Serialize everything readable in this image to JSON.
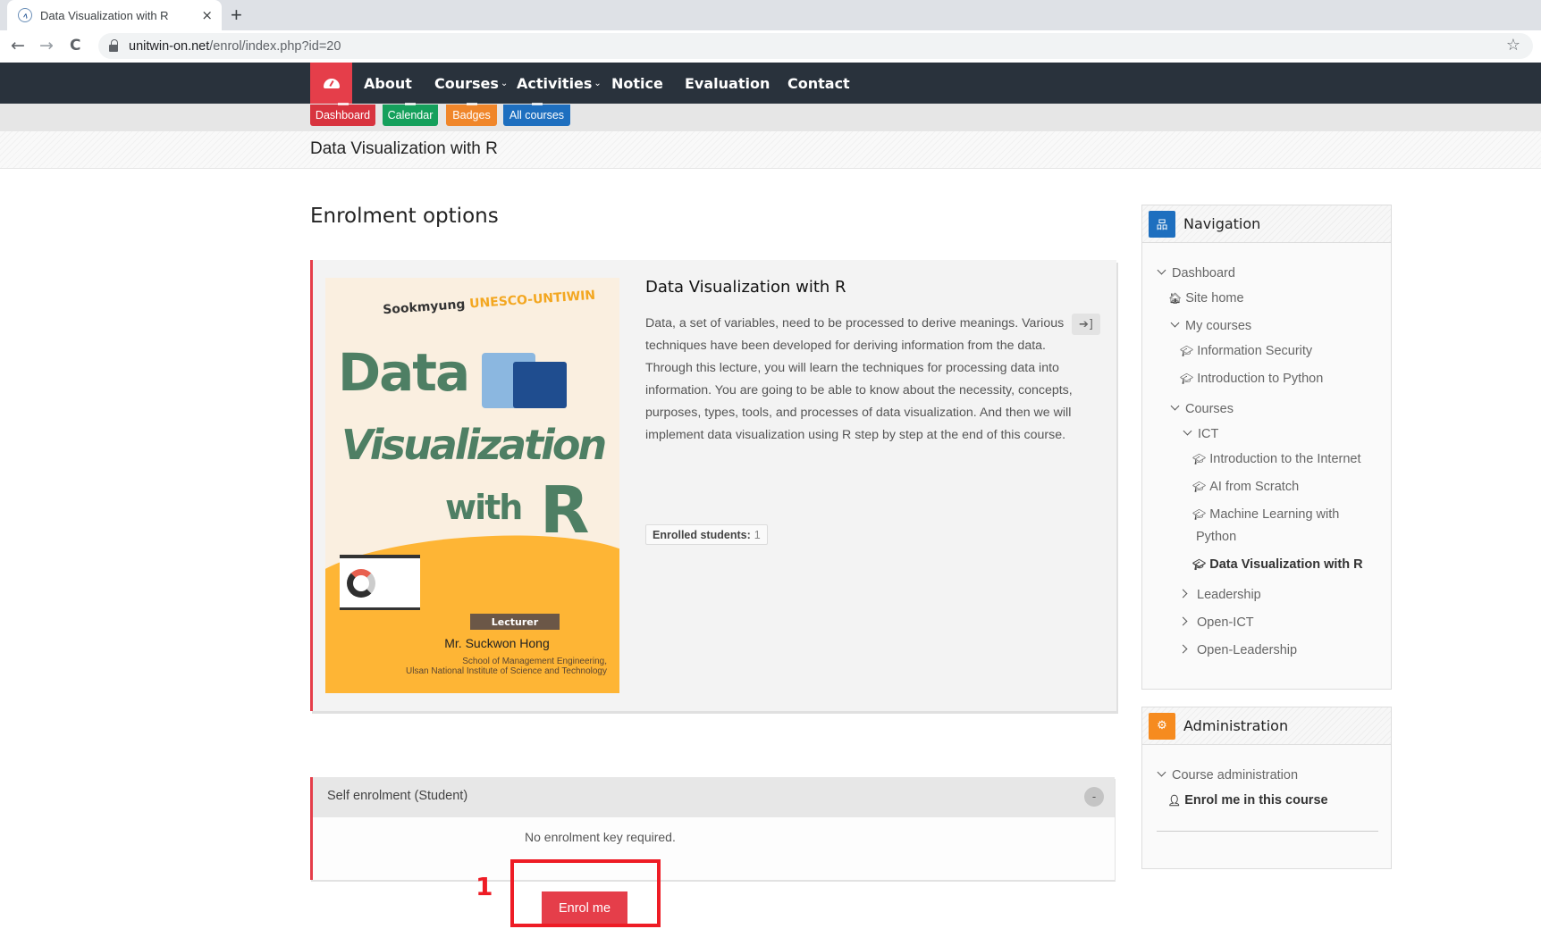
{
  "browser": {
    "tab_title": "Data Visualization with R",
    "tab_close": "×",
    "new_tab": "+",
    "back": "←",
    "forward": "→",
    "reload": "C",
    "url_host": "unitwin-on.net",
    "url_path": "/enrol/index.php?id=20",
    "bookmark": "☆"
  },
  "navbar": {
    "items": [
      {
        "label": "About"
      },
      {
        "label": "Courses",
        "chevron": "⌄"
      },
      {
        "label": "Activities",
        "chevron": "⌄"
      },
      {
        "label": "Notice"
      },
      {
        "label": "Evaluation"
      },
      {
        "label": "Contact"
      }
    ]
  },
  "quicklinks": [
    {
      "label": "Dashboard",
      "color": "#e53e4a"
    },
    {
      "label": "Calendar",
      "color": "#15a05c"
    },
    {
      "label": "Badges",
      "color": "#f0862a"
    },
    {
      "label": "All courses",
      "color": "#1e6fbf"
    }
  ],
  "page_header": {
    "title": "Data Visualization with R"
  },
  "main": {
    "heading": "Enrolment options",
    "course": {
      "title": "Data Visualization with R",
      "summary": "Data, a set of variables, need to be processed to derive meanings. Various techniques have been developed for deriving information from the data. Through this lecture, you will learn the techniques for processing data into information. You are going to be able to know about the necessity, concepts, purposes, types, tools, and processes of data visualization. And then we will implement data visualization using R step by step at the end of this course.",
      "enrolled_label": "Enrolled students:",
      "enrolled_count": "1",
      "image": {
        "top_line_a": "Sookmyung",
        "top_line_b": "UNESCO-UNTIWIN",
        "word1": "Data",
        "word2": "Visualization",
        "word3": "with",
        "word4": "R",
        "lecturer_label": "Lecturer",
        "lecturer_name": "Mr. Suckwon Hong",
        "affil1": "School of Management Engineering,",
        "affil2": "Ulsan National Institute of Science and Technology"
      }
    },
    "self_enrolment": {
      "title": "Self enrolment (Student)",
      "collapse": "-",
      "message": "No enrolment key required.",
      "button": "Enrol me"
    },
    "annotation": {
      "number": "1"
    }
  },
  "sidebar": {
    "navigation": {
      "title": "Navigation",
      "items": [
        {
          "label": "Dashboard",
          "type": "expanded"
        },
        {
          "label": "Site home",
          "type": "home"
        },
        {
          "label": "My courses",
          "type": "expanded"
        },
        {
          "label": "Information Security",
          "type": "course"
        },
        {
          "label": "Introduction to Python",
          "type": "course"
        },
        {
          "label": "Courses",
          "type": "expanded"
        },
        {
          "label": "ICT",
          "type": "expanded"
        },
        {
          "label": "Introduction to the Internet",
          "type": "course"
        },
        {
          "label": "AI from Scratch",
          "type": "course"
        },
        {
          "label": "Machine Learning with",
          "type": "course"
        },
        {
          "label": "Python",
          "type": "wrap"
        },
        {
          "label": "Data Visualization with R",
          "type": "course-active"
        },
        {
          "label": "Leadership",
          "type": "collapsed"
        },
        {
          "label": "Open-ICT",
          "type": "collapsed"
        },
        {
          "label": "Open-Leadership",
          "type": "collapsed"
        }
      ]
    },
    "administration": {
      "title": "Administration",
      "items": [
        {
          "label": "Course administration"
        },
        {
          "label": "Enrol me in this course"
        }
      ]
    }
  },
  "colors": {
    "brand_red": "#e53e4a",
    "navbar": "#29323c",
    "nav_icon_blue": "#1e6fbf",
    "admin_icon_orange": "#f68b1f"
  }
}
